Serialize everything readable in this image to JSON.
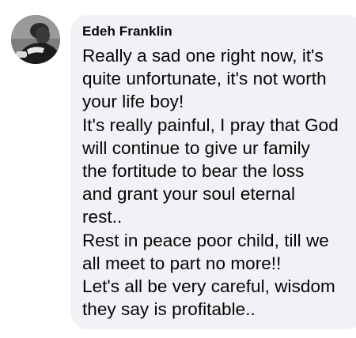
{
  "comment": {
    "author": "Edeh Franklin",
    "avatar_icon": "profile-photo",
    "lines": [
      "Really a sad one right now, it's",
      "quite unfortunate, it's not worth",
      "your life boy!",
      "It's really painful, I pray that God",
      "will continue to give ur family",
      "the fortitude to bear the loss",
      "and grant your soul eternal",
      "rest..",
      "Rest in peace poor child, till we",
      "all meet to part no more!!",
      "Let's all be very careful, wisdom",
      "they say is profitable.."
    ]
  },
  "colors": {
    "bubble_background": "#f0f2f5",
    "text": "#050505"
  }
}
